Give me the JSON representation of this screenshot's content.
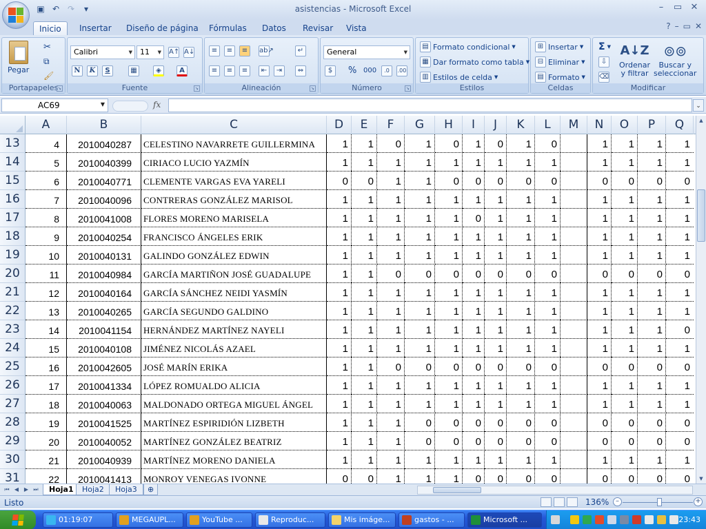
{
  "window": {
    "title": "asistencias - Microsoft Excel"
  },
  "ribbon": {
    "tabs": [
      "Inicio",
      "Insertar",
      "Diseño de página",
      "Fórmulas",
      "Datos",
      "Revisar",
      "Vista"
    ],
    "active_tab": "Inicio",
    "groups": {
      "portapapeles": {
        "label": "Portapapeles",
        "paste": "Pegar"
      },
      "fuente": {
        "label": "Fuente",
        "font_name": "Calibri",
        "font_size": "11",
        "bold": "N",
        "italic": "K",
        "underline": "S"
      },
      "alineacion": {
        "label": "Alineación"
      },
      "numero": {
        "label": "Número",
        "format": "General",
        "percent": "%",
        "thousands": "000"
      },
      "estilos": {
        "label": "Estilos",
        "conditional": "Formato condicional",
        "table": "Dar formato como tabla",
        "cell_styles": "Estilos de celda"
      },
      "celdas": {
        "label": "Celdas",
        "insert": "Insertar",
        "delete": "Eliminar",
        "format": "Formato"
      },
      "modificar": {
        "label": "Modificar",
        "sort_l1": "Ordenar",
        "sort_l2": "y filtrar",
        "find_l1": "Buscar y",
        "find_l2": "seleccionar"
      }
    }
  },
  "formula_bar": {
    "name_box": "AC69",
    "fx": "fx",
    "content": ""
  },
  "grid": {
    "columns": [
      "A",
      "B",
      "C",
      "D",
      "E",
      "F",
      "G",
      "H",
      "I",
      "J",
      "K",
      "L",
      "M",
      "N",
      "O",
      "P",
      "Q"
    ],
    "rows": [
      {
        "n": "13",
        "a": "4",
        "b": "2010040287",
        "c": "CELESTINO NAVARRETE GUILLERMINA",
        "v": [
          "1",
          "1",
          "0",
          "1",
          "0",
          "1",
          "0",
          "1",
          "0",
          "",
          "1",
          "1",
          "1",
          "1"
        ]
      },
      {
        "n": "14",
        "a": "5",
        "b": "2010040399",
        "c": "CIRIACO LUCIO YAZMÍN",
        "v": [
          "1",
          "1",
          "1",
          "1",
          "1",
          "1",
          "1",
          "1",
          "1",
          "",
          "1",
          "1",
          "1",
          "1"
        ]
      },
      {
        "n": "15",
        "a": "6",
        "b": "2010040771",
        "c": "CLEMENTE VARGAS EVA YARELI",
        "v": [
          "0",
          "0",
          "1",
          "1",
          "0",
          "0",
          "0",
          "0",
          "0",
          "",
          "0",
          "0",
          "0",
          "0"
        ]
      },
      {
        "n": "16",
        "a": "7",
        "b": "2010040096",
        "c": "CONTRERAS GONZÁLEZ MARISOL",
        "v": [
          "1",
          "1",
          "1",
          "1",
          "1",
          "1",
          "1",
          "1",
          "1",
          "",
          "1",
          "1",
          "1",
          "1"
        ]
      },
      {
        "n": "17",
        "a": "8",
        "b": "2010041008",
        "c": "FLORES MORENO MARISELA",
        "v": [
          "1",
          "1",
          "1",
          "1",
          "1",
          "0",
          "1",
          "1",
          "1",
          "",
          "1",
          "1",
          "1",
          "1"
        ]
      },
      {
        "n": "18",
        "a": "9",
        "b": "2010040254",
        "c": "FRANCISCO ÁNGELES ERIK",
        "v": [
          "1",
          "1",
          "1",
          "1",
          "1",
          "1",
          "1",
          "1",
          "1",
          "",
          "1",
          "1",
          "1",
          "1"
        ]
      },
      {
        "n": "19",
        "a": "10",
        "b": "2010040131",
        "c": "GALINDO GONZÁLEZ EDWIN",
        "v": [
          "1",
          "1",
          "1",
          "1",
          "1",
          "1",
          "1",
          "1",
          "1",
          "",
          "1",
          "1",
          "1",
          "1"
        ]
      },
      {
        "n": "20",
        "a": "11",
        "b": "2010040984",
        "c": "GARCÍA MARTIÑON JOSÉ GUADALUPE",
        "v": [
          "1",
          "1",
          "0",
          "0",
          "0",
          "0",
          "0",
          "0",
          "0",
          "",
          "0",
          "0",
          "0",
          "0"
        ]
      },
      {
        "n": "21",
        "a": "12",
        "b": "2010040164",
        "c": "GARCÍA SÁNCHEZ NEIDI YASMÍN",
        "v": [
          "1",
          "1",
          "1",
          "1",
          "1",
          "1",
          "1",
          "1",
          "1",
          "",
          "1",
          "1",
          "1",
          "1"
        ]
      },
      {
        "n": "22",
        "a": "13",
        "b": "2010040265",
        "c": "GARCÍA SEGUNDO GALDINO",
        "v": [
          "1",
          "1",
          "1",
          "1",
          "1",
          "1",
          "1",
          "1",
          "1",
          "",
          "1",
          "1",
          "1",
          "1"
        ]
      },
      {
        "n": "23",
        "a": "14",
        "b": "2010041154",
        "c": "HERNÁNDEZ MARTÍNEZ NAYELI",
        "v": [
          "1",
          "1",
          "1",
          "1",
          "1",
          "1",
          "1",
          "1",
          "1",
          "",
          "1",
          "1",
          "1",
          "0"
        ]
      },
      {
        "n": "24",
        "a": "15",
        "b": "2010040108",
        "c": "JIMÉNEZ NICOLÁS AZAEL",
        "v": [
          "1",
          "1",
          "1",
          "1",
          "1",
          "1",
          "1",
          "1",
          "1",
          "",
          "1",
          "1",
          "1",
          "1"
        ]
      },
      {
        "n": "25",
        "a": "16",
        "b": "2010042605",
        "c": "JOSÉ MARÍN ERIKA",
        "v": [
          "1",
          "1",
          "0",
          "0",
          "0",
          "0",
          "0",
          "0",
          "0",
          "",
          "0",
          "0",
          "0",
          "0"
        ]
      },
      {
        "n": "26",
        "a": "17",
        "b": "2010041334",
        "c": "LÓPEZ ROMUALDO ALICIA",
        "v": [
          "1",
          "1",
          "1",
          "1",
          "1",
          "1",
          "1",
          "1",
          "1",
          "",
          "1",
          "1",
          "1",
          "1"
        ]
      },
      {
        "n": "27",
        "a": "18",
        "b": "2010040063",
        "c": "MALDONADO ORTEGA MIGUEL ÁNGEL",
        "v": [
          "1",
          "1",
          "1",
          "1",
          "1",
          "1",
          "1",
          "1",
          "1",
          "",
          "1",
          "1",
          "1",
          "1"
        ]
      },
      {
        "n": "28",
        "a": "19",
        "b": "2010041525",
        "c": "MARTÍNEZ ESPIRIDIÓN LIZBETH",
        "v": [
          "1",
          "1",
          "1",
          "0",
          "0",
          "0",
          "0",
          "0",
          "0",
          "",
          "0",
          "0",
          "0",
          "0"
        ]
      },
      {
        "n": "29",
        "a": "20",
        "b": "2010040052",
        "c": "MARTÍNEZ GONZÁLEZ BEATRIZ",
        "v": [
          "1",
          "1",
          "1",
          "0",
          "0",
          "0",
          "0",
          "0",
          "0",
          "",
          "0",
          "0",
          "0",
          "0"
        ]
      },
      {
        "n": "30",
        "a": "21",
        "b": "2010040939",
        "c": "MARTÍNEZ MORENO DANIELA",
        "v": [
          "1",
          "1",
          "1",
          "1",
          "1",
          "1",
          "1",
          "1",
          "1",
          "",
          "1",
          "1",
          "1",
          "1"
        ]
      },
      {
        "n": "31",
        "a": "22",
        "b": "2010041413",
        "c": "MONROY VENEGAS IVONNE",
        "v": [
          "0",
          "0",
          "1",
          "1",
          "1",
          "0",
          "0",
          "0",
          "0",
          "",
          "0",
          "0",
          "0",
          "0"
        ]
      }
    ]
  },
  "sheets": {
    "tabs": [
      "Hoja1",
      "Hoja2",
      "Hoja3"
    ],
    "active": "Hoja1"
  },
  "status": {
    "text": "Listo",
    "zoom": "136%"
  },
  "taskbar": {
    "items": [
      {
        "label": "01:19:07",
        "color": "#39b6f0"
      },
      {
        "label": "MEGAUPL...",
        "color": "#e0a020"
      },
      {
        "label": "YouTube ...",
        "color": "#e0a020"
      },
      {
        "label": "Reproduc...",
        "color": "#e8e8e8"
      },
      {
        "label": "Mis imáge...",
        "color": "#f3d36b"
      },
      {
        "label": "gastos - ...",
        "color": "#c04020"
      },
      {
        "label": "Microsoft ...",
        "color": "#1e8f3a"
      }
    ],
    "clock": "23:43"
  }
}
